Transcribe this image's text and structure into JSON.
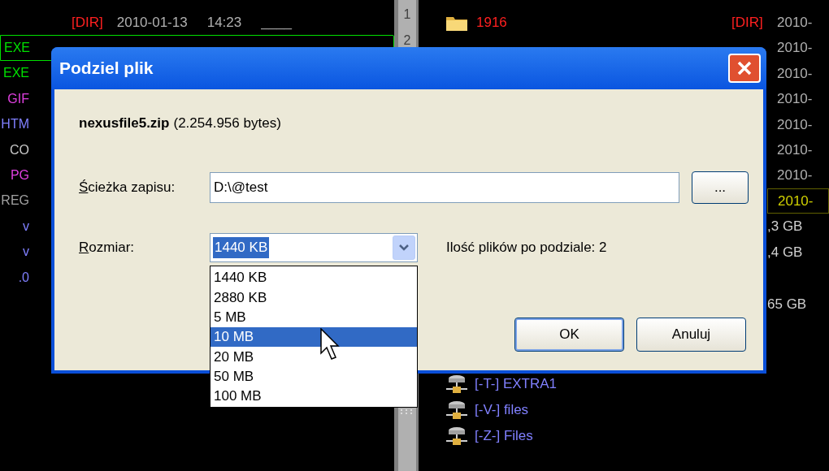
{
  "left_panel": {
    "dir_row": {
      "type": "[DIR]",
      "date": "2010-01-13",
      "time": "14:23",
      "attributes": "____"
    },
    "extensions": [
      {
        "text": "EXE",
        "color": "#00e000",
        "highlighted": true
      },
      {
        "text": "EXE",
        "color": "#00e000",
        "highlighted": false
      },
      {
        "text": "GIF",
        "color": "#e040e0",
        "highlighted": false
      },
      {
        "text": "HTM",
        "color": "#8080ff",
        "highlighted": false
      },
      {
        "text": "CO",
        "color": "#c8c8c8",
        "highlighted": false
      },
      {
        "text": "PG",
        "color": "#e040e0",
        "highlighted": false
      },
      {
        "text": "REG",
        "color": "#a0a0a0",
        "highlighted": false
      },
      {
        "text": "v",
        "color": "#8080ff",
        "highlighted": false
      },
      {
        "text": "v",
        "color": "#8080ff",
        "highlighted": false
      },
      {
        "text": ".0",
        "color": "#8080ff",
        "highlighted": false
      }
    ]
  },
  "divider": {
    "numbers": [
      "1",
      "2"
    ]
  },
  "right_panel": {
    "folder": {
      "name": "1916"
    },
    "types": [
      "[DIR]"
    ],
    "dates": [
      {
        "text": "2010-",
        "highlighted": false
      },
      {
        "text": "2010-",
        "highlighted": false
      },
      {
        "text": "2010-",
        "highlighted": false
      },
      {
        "text": "2010-",
        "highlighted": false
      },
      {
        "text": "2010-",
        "highlighted": false
      },
      {
        "text": "2010-",
        "highlighted": false
      },
      {
        "text": "2010-",
        "highlighted": false
      },
      {
        "text": "2010-",
        "highlighted": true
      }
    ],
    "sizes": [
      ",3 GB",
      ",4 GB",
      "65 GB"
    ],
    "drives": [
      "[-T-] EXTRA1",
      "[-V-] files",
      "[-Z-] Files"
    ]
  },
  "dialog": {
    "title": "Podziel plik",
    "file_name": "nexusfile5.zip",
    "file_size": "(2.254.956 bytes)",
    "path_label": {
      "text": "Ścieżka zapisu:",
      "mnemonic": true
    },
    "path_value": "D:\\@test",
    "browse_button": "...",
    "size_label": {
      "text": "Rozmiar:",
      "mnemonic": true
    },
    "size_value": "1440 KB",
    "file_count": "Ilość plików po podziale: 2",
    "size_options": [
      {
        "label": "1440 KB",
        "selected": false
      },
      {
        "label": "2880 KB",
        "selected": false
      },
      {
        "label": "5 MB",
        "selected": false
      },
      {
        "label": "10 MB",
        "selected": true
      },
      {
        "label": "20 MB",
        "selected": false
      },
      {
        "label": "50 MB",
        "selected": false
      },
      {
        "label": "100 MB",
        "selected": false
      }
    ],
    "buttons": [
      {
        "label": "OK",
        "default": true
      },
      {
        "label": "Anuluj",
        "default": false
      }
    ]
  }
}
